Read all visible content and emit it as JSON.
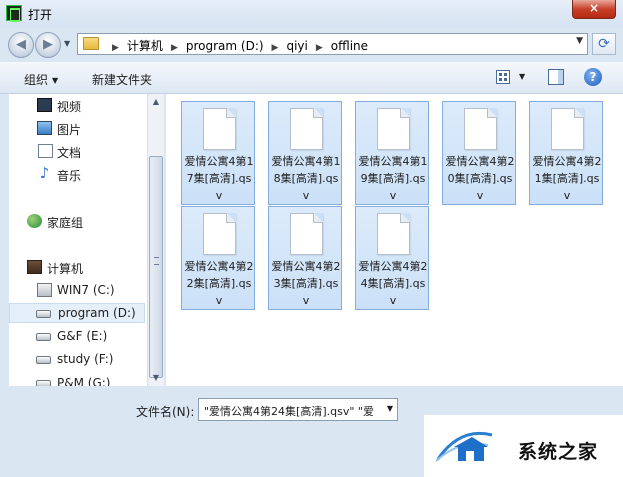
{
  "window": {
    "title": "打开",
    "close_label": "×"
  },
  "navbar": {
    "back_label": "◀",
    "forward_label": "▶",
    "dropdown_label": "▼",
    "breadcrumbs": [
      "计算机",
      "program (D:)",
      "qiyi",
      "offline"
    ],
    "refresh_label": "⟳",
    "address_dropdown": "▼"
  },
  "toolbar": {
    "organize_label": "组织",
    "organize_arrow": "▼",
    "new_folder_label": "新建文件夹",
    "views_arrow": "▼",
    "help_label": "?"
  },
  "sidebar": {
    "items": [
      {
        "label": "视频",
        "icon": "video-icon"
      },
      {
        "label": "图片",
        "icon": "pictures-icon"
      },
      {
        "label": "文档",
        "icon": "documents-icon"
      },
      {
        "label": "音乐",
        "icon": "music-icon",
        "glyph": "♪"
      },
      {
        "label": "家庭组",
        "icon": "homegroup-icon"
      },
      {
        "label": "计算机",
        "icon": "computer-icon"
      },
      {
        "label": "WIN7 (C:)",
        "icon": "windows-drive-icon"
      },
      {
        "label": "program (D:)",
        "icon": "drive-icon",
        "selected": true
      },
      {
        "label": "G&F (E:)",
        "icon": "drive-icon"
      },
      {
        "label": "study (F:)",
        "icon": "drive-icon"
      },
      {
        "label": "P&M (G:)",
        "icon": "drive-icon"
      }
    ],
    "scroll_up": "▲",
    "scroll_down": "▼"
  },
  "files": [
    {
      "name": "爱情公寓4第17集[高清].qsv"
    },
    {
      "name": "爱情公寓4第18集[高清].qsv"
    },
    {
      "name": "爱情公寓4第19集[高清].qsv"
    },
    {
      "name": "爱情公寓4第20集[高清].qsv"
    },
    {
      "name": "爱情公寓4第21集[高清].qsv"
    },
    {
      "name": "爱情公寓4第22集[高清].qsv"
    },
    {
      "name": "爱情公寓4第23集[高清].qsv"
    },
    {
      "name": "爱情公寓4第24集[高清].qsv"
    }
  ],
  "filename": {
    "label": "文件名(N):",
    "value": "\"爱情公寓4第24集[高清].qsv\" \"爱",
    "dropdown": "▼"
  },
  "watermark": {
    "text": "系统之家"
  },
  "colors": {
    "selection": "#cbe0f7",
    "selection_border": "#84acdd",
    "accent": "#1f5cbf"
  }
}
